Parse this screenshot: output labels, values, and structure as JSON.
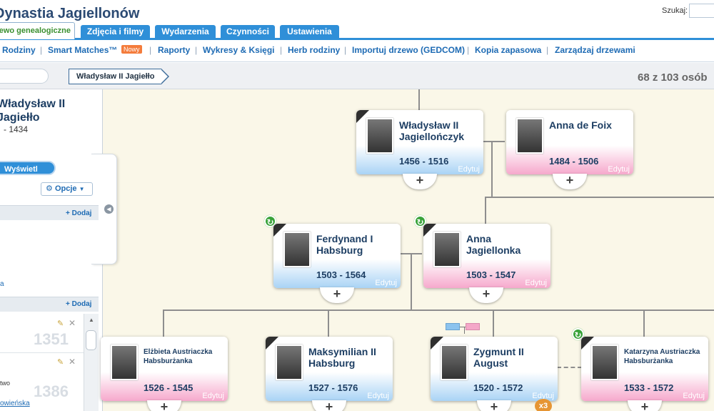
{
  "app": {
    "title": "Dynastia Jagiellonów"
  },
  "search": {
    "label": "Szukaj:"
  },
  "tabs": [
    {
      "label": "Drzewo genealogiczne",
      "active": true
    },
    {
      "label": "Zdjęcia i filmy"
    },
    {
      "label": "Wydarzenia"
    },
    {
      "label": "Czynności"
    },
    {
      "label": "Ustawienia"
    }
  ],
  "subnav": {
    "items": [
      "Rodziny",
      "Smart Matches™",
      "Raporty",
      "Wykresy & Księgi",
      "Herb rodziny",
      "Importuj drzewo (GEDCOM)",
      "Kopia zapasowa",
      "Zarządzaj drzewami"
    ],
    "new_badge": "Nowy"
  },
  "breadcrumb": {
    "current": "Władysław II Jagiełło"
  },
  "person_count": "68 z 103 osób",
  "profile": {
    "name": "Władysław II Jagiełło",
    "dates": "- 1434",
    "view_profile": "Wyświetl profil",
    "options": "Opcje"
  },
  "panel": {
    "add_label": "Dodaj",
    "frag_a": "a",
    "row1_num": "1351",
    "row2_num": "1386",
    "frag_two": "two",
    "frag_link": "owieńska"
  },
  "colors": {
    "tab_blue": "#2f8fd8",
    "male": "#a9d3f5",
    "female": "#f6a8cc",
    "match_green": "#3aa33a",
    "badge_orange": "#e69533"
  },
  "tree": {
    "edit_label": "Edytuj",
    "multi_badge": "x3",
    "cards": [
      {
        "id": "wladyslaw",
        "name": "Władysław II Jagiellończyk",
        "dates": "1456 - 1516",
        "gender": "male"
      },
      {
        "id": "anna-foix",
        "name": "Anna de Foix",
        "dates": "1484 - 1506",
        "gender": "female"
      },
      {
        "id": "ferdynand",
        "name": "Ferdynand I Habsburg",
        "dates": "1503 - 1564",
        "gender": "male",
        "smart_match": true
      },
      {
        "id": "anna-jag",
        "name": "Anna Jagiellonka",
        "dates": "1503 - 1547",
        "gender": "female",
        "smart_match": true
      },
      {
        "id": "elzbieta",
        "name": "Elżbieta Austriaczka Habsburżanka",
        "dates": "1526 - 1545",
        "gender": "female"
      },
      {
        "id": "maksymilian",
        "name": "Maksymilian II Habsburg",
        "dates": "1527 - 1576",
        "gender": "male"
      },
      {
        "id": "zygmunt",
        "name": "Zygmunt II August",
        "dates": "1520 - 1572",
        "gender": "male"
      },
      {
        "id": "katarzyna",
        "name": "Katarzyna Austriaczka Habsburżanka",
        "dates": "1533 - 1572",
        "gender": "female",
        "smart_match": true
      }
    ]
  }
}
